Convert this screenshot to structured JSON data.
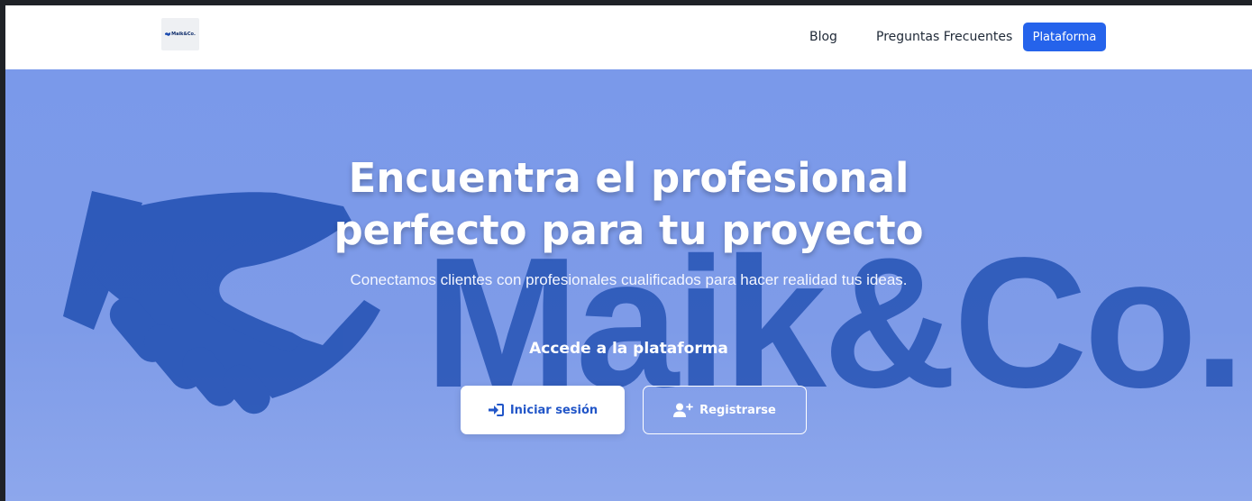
{
  "header": {
    "logo_text": "Maik&Co.",
    "nav": {
      "blog": "Blog",
      "faq": "Preguntas Frecuentes",
      "platform": "Plataforma"
    }
  },
  "hero": {
    "watermark_text": "Maik&Co.",
    "title_line1": "Encuentra el profesional",
    "title_line2": "perfecto para tu proyecto",
    "subtitle": "Conectamos clientes con profesionales cualificados para hacer realidad tus ideas.",
    "access_title": "Accede a la plataforma",
    "login_button": "Iniciar sesión",
    "register_button": "Registrarse"
  },
  "icons": {
    "logo": "handshake-icon",
    "login": "sign-in-icon",
    "register": "user-plus-icon",
    "background": "handshake-icon"
  },
  "colors": {
    "primary": "#2563eb",
    "hero_background": "#7f9ded",
    "watermark": "#1e4db0",
    "header_background": "#ffffff"
  }
}
